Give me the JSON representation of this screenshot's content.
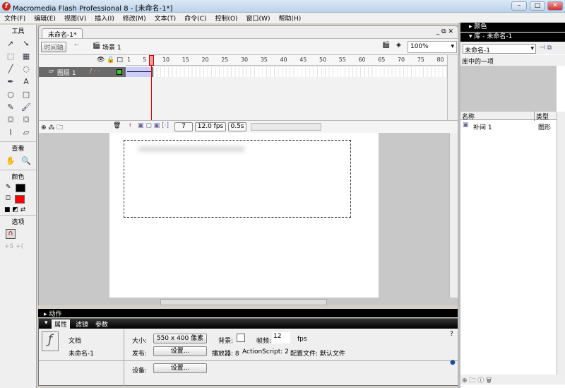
{
  "window": {
    "title": "Macromedia Flash Professional 8 - [未命名-1*]",
    "minimize": "–",
    "maximize": "□",
    "close": "✕"
  },
  "menu": [
    "文件(F)",
    "编辑(E)",
    "视图(V)",
    "插入(I)",
    "修改(M)",
    "文本(T)",
    "命令(C)",
    "控制(O)",
    "窗口(W)",
    "帮助(H)"
  ],
  "toolbox": {
    "title": "工具",
    "tools": [
      "selection",
      "subselection",
      "free-transform",
      "fill-transform",
      "line",
      "lasso",
      "pen",
      "text",
      "oval",
      "rectangle",
      "pencil",
      "brush",
      "ink-bottle",
      "paint-bucket",
      "eyedropper",
      "eraser"
    ],
    "tool_glyphs": [
      "➚",
      "➘",
      "⬚",
      "▦",
      "╱",
      "◌",
      "✒",
      "A",
      "○",
      "□",
      "✎",
      "🖌",
      "⛋",
      "⛋",
      "⌇",
      "▱"
    ],
    "view_label": "查看",
    "color_label": "颜色",
    "options_label": "选项",
    "stroke_color": "#000000",
    "fill_color": "#ff0000"
  },
  "document": {
    "tab": "未命名-1*",
    "timeline_button": "时间轴",
    "scene": "场景 1",
    "zoom": "100%",
    "ruler": [
      "1",
      "5",
      "10",
      "15",
      "20",
      "25",
      "30",
      "35",
      "40",
      "45",
      "50",
      "55",
      "60",
      "65",
      "70",
      "75",
      "80"
    ],
    "layer": "图层 1",
    "current_frame": "7",
    "fps": "12.0 fps",
    "time": "0.5s",
    "playhead_frame": 7,
    "tween_start": 1,
    "tween_end": 7
  },
  "actions_panel": "动作",
  "properties": {
    "tabs": [
      "属性",
      "滤镜",
      "参数"
    ],
    "doc_type": "文档",
    "doc_name": "未命名-1",
    "size_label": "大小:",
    "size_value": "550 x 400 像素",
    "bg_label": "背景:",
    "fps_label": "帧频:",
    "fps_value": "12",
    "fps_unit": "fps",
    "publish_label": "发布:",
    "settings": "设置...",
    "player": "播放器: 8",
    "actionscript": "ActionScript:  2",
    "profile": "配置文件:  默认文件",
    "device_label": "设备:",
    "device_settings": "设置..."
  },
  "right_panel": {
    "color_header": "颜色",
    "library_header": "库 - 未命名-1",
    "library_select": "未命名-1",
    "item_count": "库中的一项",
    "col_name": "名称",
    "col_type": "类型",
    "items": [
      {
        "name": "补间 1",
        "type": "图形"
      }
    ]
  }
}
